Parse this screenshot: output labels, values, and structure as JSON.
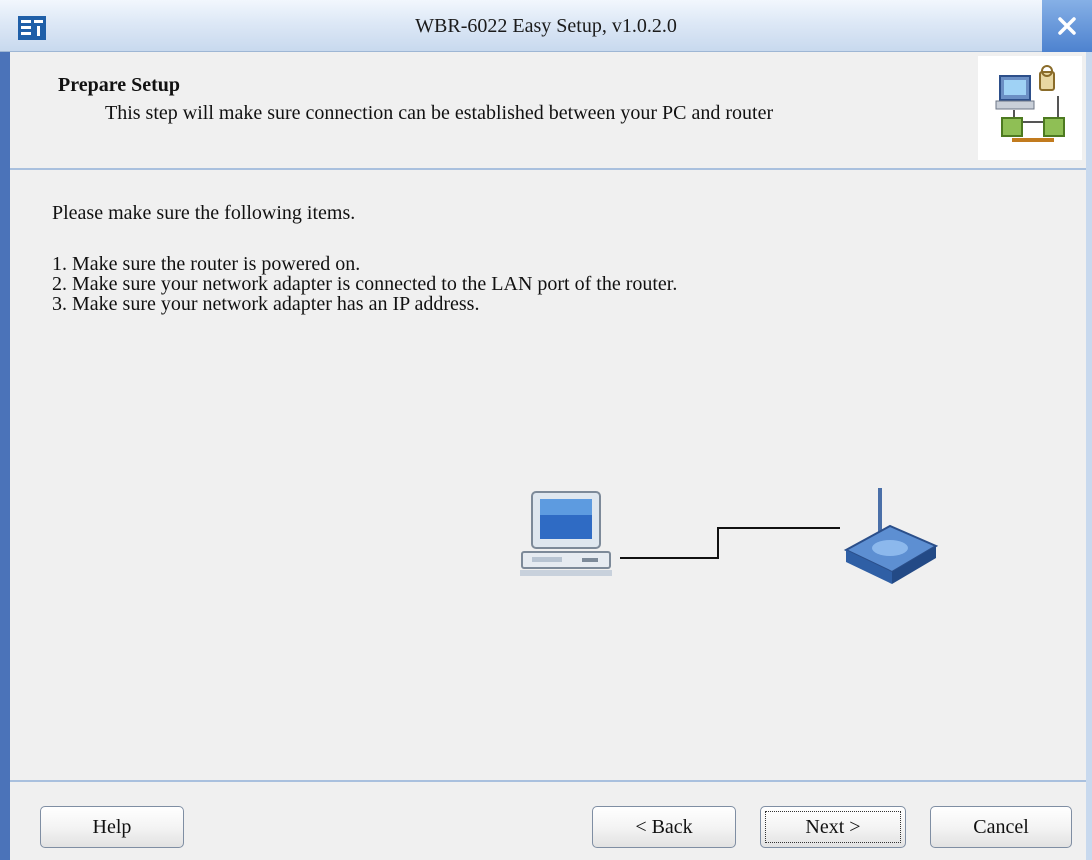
{
  "window": {
    "title": "WBR-6022 Easy Setup, v1.0.2.0",
    "app_icon": "app-logo-icon",
    "close_icon": "close-icon"
  },
  "header": {
    "title": "Prepare Setup",
    "description": "This step will make sure connection can be established between your PC and router",
    "image": "network-setup-icon"
  },
  "main": {
    "intro": "Please make sure the following items.",
    "steps": [
      "1. Make sure the router is powered on.",
      "2. Make sure your network adapter is connected to the LAN port of the router.",
      "3. Make sure your network adapter has an IP address."
    ],
    "diagram": {
      "pc_icon": "computer-icon",
      "router_icon": "router-icon"
    }
  },
  "buttons": {
    "help": "Help",
    "back": "< Back",
    "next": "Next >",
    "cancel": "Cancel"
  },
  "colors": {
    "titlebar": "#dde8f6",
    "close_button": "#4d82cf",
    "frame": "#4b73b9",
    "separator": "#a9c0de",
    "background": "#f0f0f0"
  }
}
